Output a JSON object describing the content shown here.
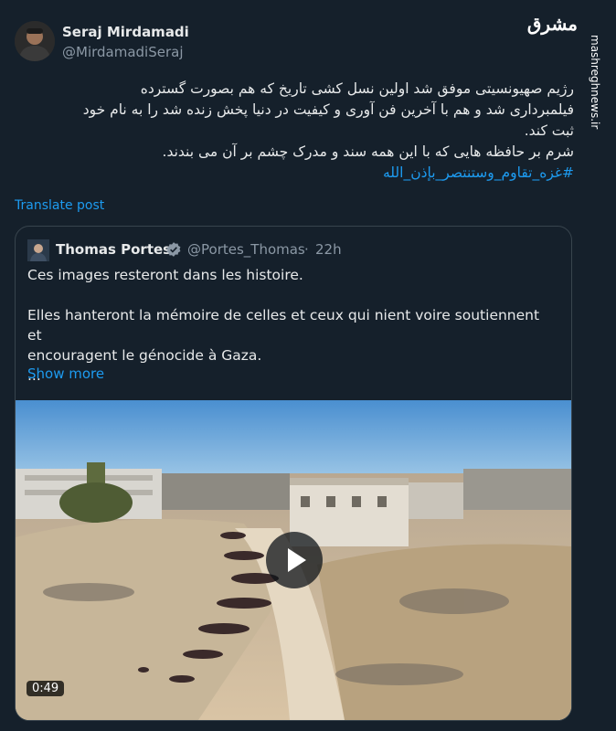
{
  "author": {
    "name": "Seraj Mirdamadi",
    "handle": "@MirdamadiSeraj"
  },
  "watermark": {
    "logo": "مشرق",
    "url": "mashreghnews.ir"
  },
  "tweet": {
    "lines": [
      "رژیم صهیونسیتی موفق شد اولین نسل کشی تاریخ که هم بصورت گسترده",
      "فیلمبرداری شد و هم با آخرین فن آوری و کیفیت در دنیا پخش زنده شد را به نام خود",
      "ثبت کند.",
      "شرم بر حافظه هایی که با این همه سند و مدرک چشم بر آن می بندند."
    ],
    "hashtag": "#غزه_تقاوم_وستنتصر_بإذن_الله"
  },
  "translate_label": "Translate post",
  "quote": {
    "name": "Thomas Portes",
    "handle": "@Portes_Thomas",
    "dot": "·",
    "time": "22h",
    "lines": [
      "Ces images resteront dans les histoire.",
      "",
      "Elles hanteront la mémoire de celles et ceux qui nient voire soutiennent et",
      "encouragent le génocide à Gaza.",
      "..."
    ],
    "show_more": "Show more",
    "video": {
      "duration": "0:49"
    }
  },
  "colors": {
    "background": "#15202b",
    "text": "#e7e9ea",
    "muted": "#8b98a5",
    "accent": "#1d9bf0",
    "border": "#38444d"
  },
  "icons": [
    "verified-badge-icon",
    "play-icon"
  ]
}
